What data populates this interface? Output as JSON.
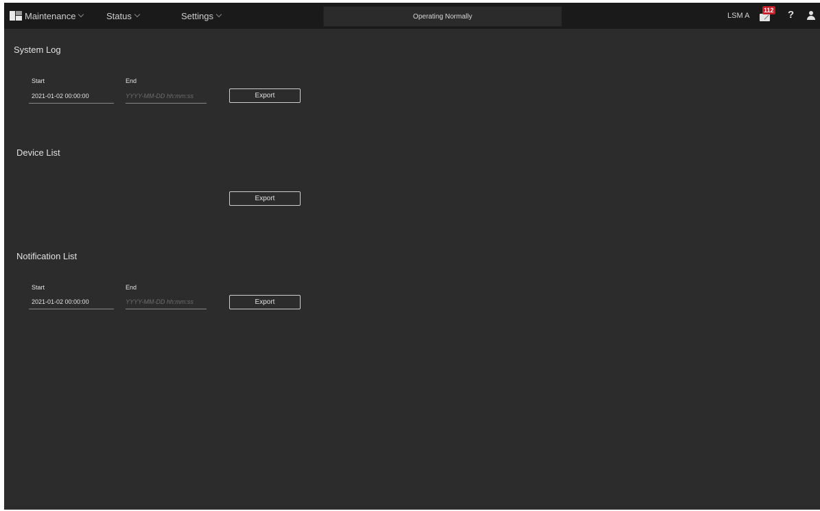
{
  "header": {
    "menus": [
      {
        "label": "Maintenance"
      },
      {
        "label": "Status"
      },
      {
        "label": "Settings"
      }
    ],
    "status_text": "Operating Normally",
    "station_name": "LSM A",
    "notification_count": "112",
    "help_label": "?"
  },
  "sections": {
    "system_log": {
      "title": "System Log",
      "start_label": "Start",
      "start_value": "2021-01-02 00:00:00",
      "end_label": "End",
      "end_placeholder": "YYYY-MM-DD hh:mm:ss",
      "export_label": "Export"
    },
    "device_list": {
      "title": "Device List",
      "export_label": "Export"
    },
    "notification_list": {
      "title": "Notification List",
      "start_label": "Start",
      "start_value": "2021-01-02 00:00:00",
      "end_label": "End",
      "end_placeholder": "YYYY-MM-DD hh:mm:ss",
      "export_label": "Export"
    }
  },
  "colors": {
    "background": "#2c2c2c",
    "topbar": "#1a1a1a",
    "badge": "#c7202c"
  },
  "icons": {
    "logo": "grid-logo-icon",
    "mail": "envelope-icon",
    "help": "question-icon",
    "user": "user-icon"
  }
}
